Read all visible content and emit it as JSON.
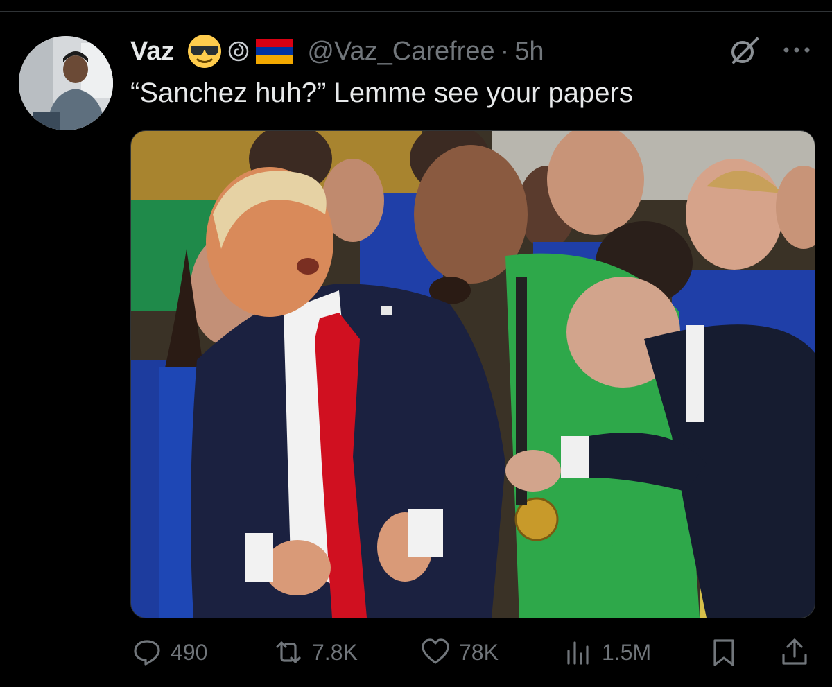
{
  "tweet": {
    "author_name": "Vaz",
    "handle": "@Vaz_Carefree",
    "separator": "·",
    "time": "5h",
    "text": "“Sanchez huh?” Lemme see your papers",
    "emoji_icon": "sunglasses-emoji-icon",
    "badge_icon": "swirl-badge-icon",
    "flag_icon": "armenia-flag-icon",
    "flag_colors": [
      "#d90012",
      "#0033a0",
      "#f2a800"
    ]
  },
  "actions": {
    "replies": "490",
    "reposts": "7.8K",
    "likes": "78K",
    "views": "1.5M"
  },
  "colors": {
    "background": "#000000",
    "text": "#e7e9ea",
    "secondary": "#71767b"
  }
}
